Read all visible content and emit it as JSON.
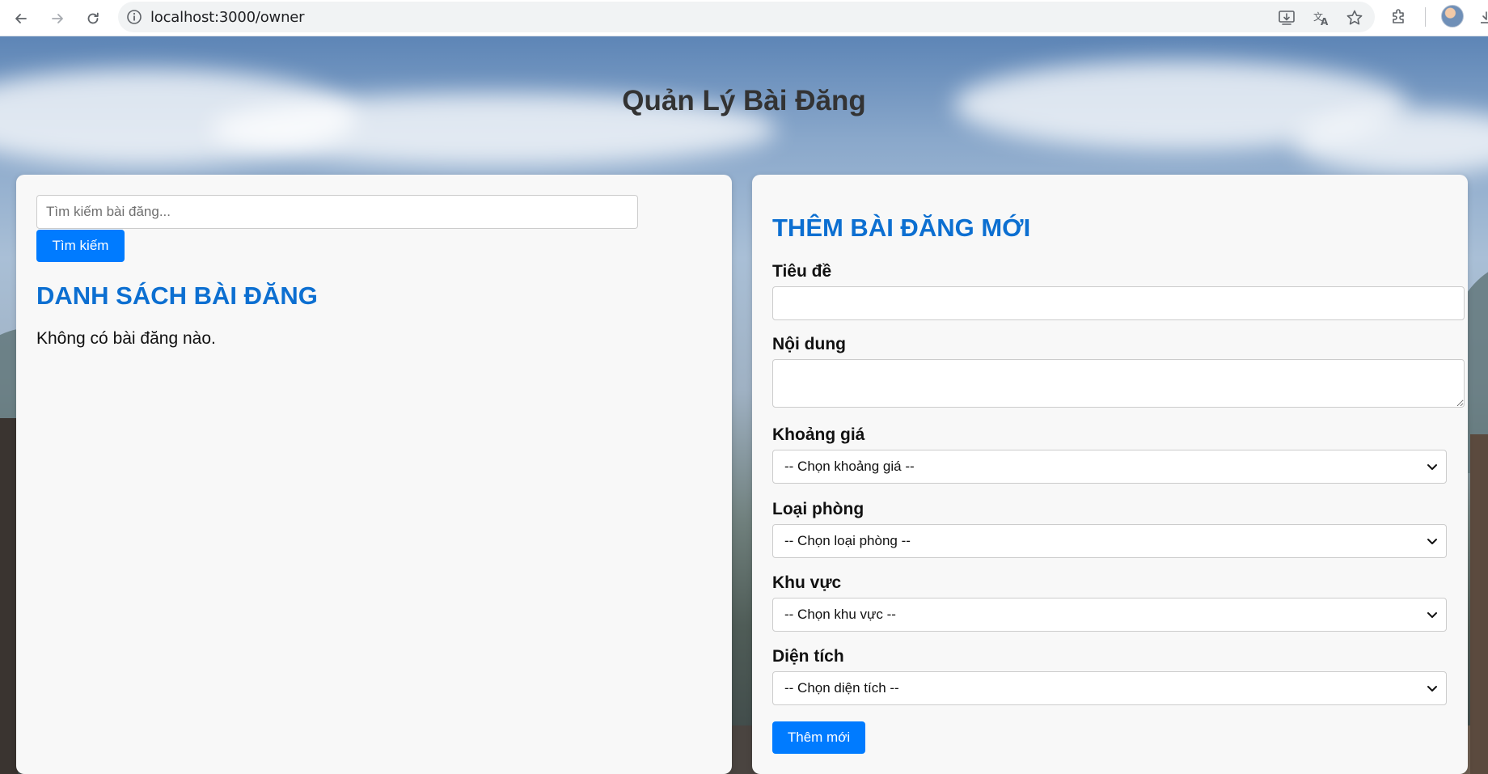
{
  "browser": {
    "url": "localhost:3000/owner"
  },
  "page": {
    "title": "Quản Lý Bài Đăng"
  },
  "search": {
    "placeholder": "Tìm kiếm bài đăng...",
    "value": "",
    "button_label": "Tìm kiếm"
  },
  "list": {
    "heading": "DANH SÁCH BÀI ĐĂNG",
    "empty_message": "Không có bài đăng nào."
  },
  "form": {
    "heading": "THÊM BÀI ĐĂNG MỚI",
    "title_label": "Tiêu đề",
    "title_value": "",
    "content_label": "Nội dung",
    "content_value": "",
    "price_label": "Khoảng giá",
    "price_selected": "-- Chọn khoảng giá --",
    "room_type_label": "Loại phòng",
    "room_type_selected": "-- Chọn loại phòng --",
    "area_label": "Khu vực",
    "area_selected": "-- Chọn khu vực --",
    "size_label": "Diện tích",
    "size_selected": "-- Chọn diện tích --",
    "submit_label": "Thêm mới"
  },
  "colors": {
    "primary_button": "#007bff",
    "heading_blue": "#0c6fd1",
    "panel_bg": "#f8f8f8"
  },
  "icons": {
    "back": "arrow-left-icon",
    "forward": "arrow-right-icon",
    "reload": "reload-icon",
    "site_info": "info-icon",
    "install": "install-app-icon",
    "translate": "translate-icon",
    "bookmark": "star-icon",
    "extensions": "puzzle-icon",
    "select_arrow": "chevron-down-icon"
  }
}
